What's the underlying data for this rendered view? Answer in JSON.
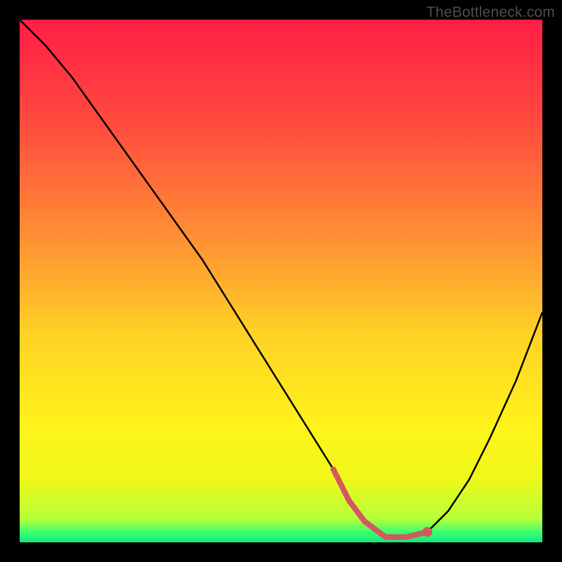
{
  "watermark": "TheBottleneck.com",
  "chart_data": {
    "type": "line",
    "title": "",
    "xlabel": "",
    "ylabel": "",
    "xlim": [
      0,
      100
    ],
    "ylim": [
      0,
      100
    ],
    "x": [
      0,
      5,
      10,
      15,
      20,
      25,
      30,
      35,
      40,
      45,
      50,
      55,
      60,
      63,
      66,
      70,
      74,
      78,
      82,
      86,
      90,
      95,
      100
    ],
    "values": [
      100,
      95,
      89,
      82,
      75,
      68,
      61,
      54,
      46,
      38,
      30,
      22,
      14,
      8,
      4,
      1,
      1,
      2,
      6,
      12,
      20,
      31,
      44
    ],
    "highlight": {
      "x": [
        60,
        63,
        66,
        70,
        74,
        78
      ],
      "values": [
        14,
        8,
        4,
        1,
        1,
        2
      ]
    },
    "gradient_stops": [
      {
        "offset": 0.0,
        "color": "#ff1e46"
      },
      {
        "offset": 0.2,
        "color": "#ff4b3e"
      },
      {
        "offset": 0.4,
        "color": "#ff8a35"
      },
      {
        "offset": 0.6,
        "color": "#ffd125"
      },
      {
        "offset": 0.78,
        "color": "#fff31a"
      },
      {
        "offset": 0.88,
        "color": "#eef819"
      },
      {
        "offset": 0.955,
        "color": "#b6ff3a"
      },
      {
        "offset": 0.985,
        "color": "#2aff78"
      },
      {
        "offset": 1.0,
        "color": "#17e37a"
      }
    ],
    "colors": {
      "curve": "#000000",
      "highlight_stroke": "#d15a5e",
      "highlight_dot": "#d15a5e"
    }
  }
}
